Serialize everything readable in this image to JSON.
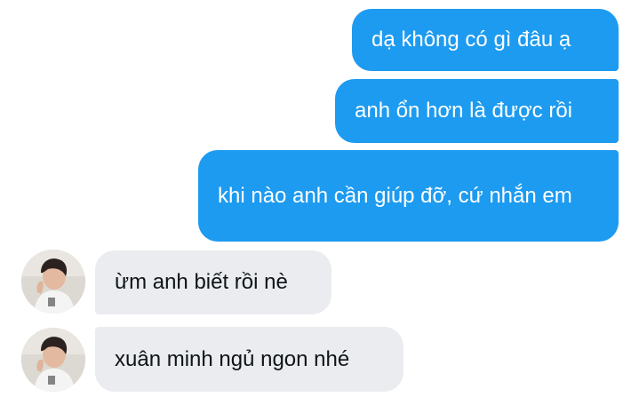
{
  "thread": {
    "messages": [
      {
        "direction": "outgoing",
        "text": "dạ không có gì đâu ạ"
      },
      {
        "direction": "outgoing",
        "text": "anh ổn hơn là được rồi"
      },
      {
        "direction": "outgoing",
        "text": "khi nào anh cần giúp đỡ, cứ nhắn em"
      },
      {
        "direction": "incoming",
        "text": "ừm anh biết rồi nè"
      },
      {
        "direction": "incoming",
        "text": "xuân minh ngủ ngon nhé"
      }
    ]
  },
  "colors": {
    "outgoing_bubble": "#1d9bf0",
    "incoming_bubble": "#eaecef"
  }
}
